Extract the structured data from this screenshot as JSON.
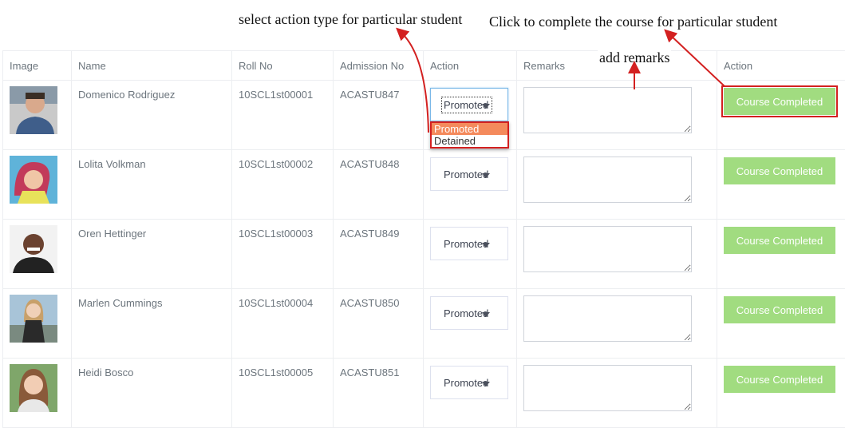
{
  "annotations": {
    "select_action": "select action type for particular student",
    "complete_course": "Click to complete the course for particular student",
    "add_remarks": "add remarks"
  },
  "table": {
    "headers": [
      "Image",
      "Name",
      "Roll No",
      "Admission No",
      "Action",
      "Remarks",
      "Action"
    ],
    "rows": [
      {
        "name": "Domenico Rodriguez",
        "roll": "10SCL1st00001",
        "admission": "ACASTU847",
        "action": "Promoted",
        "button": "Course Completed"
      },
      {
        "name": "Lolita Volkman",
        "roll": "10SCL1st00002",
        "admission": "ACASTU848",
        "action": "Promoted",
        "button": "Course Completed"
      },
      {
        "name": "Oren Hettinger",
        "roll": "10SCL1st00003",
        "admission": "ACASTU849",
        "action": "Promoted",
        "button": "Course Completed"
      },
      {
        "name": "Marlen Cummings",
        "roll": "10SCL1st00004",
        "admission": "ACASTU850",
        "action": "Promoted",
        "button": "Course Completed"
      },
      {
        "name": "Heidi Bosco",
        "roll": "10SCL1st00005",
        "admission": "ACASTU851",
        "action": "Promoted",
        "button": "Course Completed"
      }
    ]
  },
  "dropdown_options": [
    "Promoted",
    "Detained"
  ],
  "colors": {
    "button": "#a1dc80",
    "highlight": "#d32020",
    "option_active": "#f48a5c"
  }
}
